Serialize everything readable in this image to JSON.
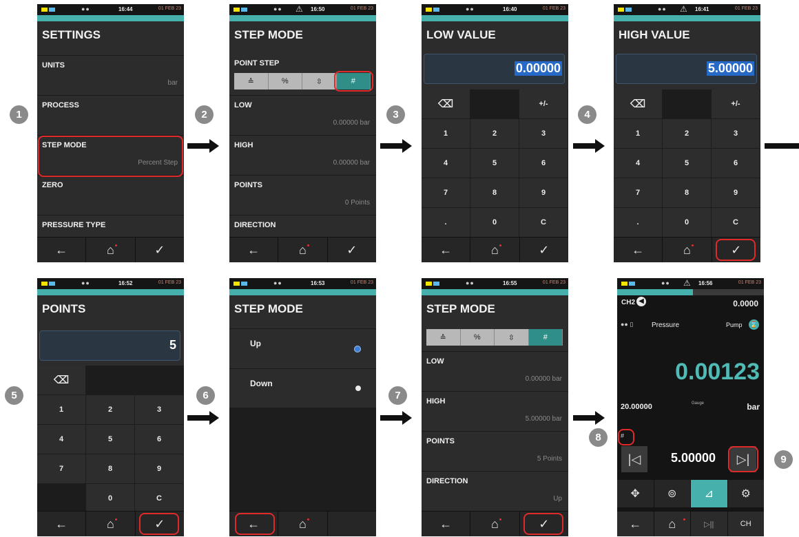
{
  "status": {
    "dots": "●●",
    "times": [
      "16:44",
      "16:50",
      "16:40",
      "16:41",
      "16:52",
      "16:53",
      "16:55",
      "16:56"
    ],
    "date": "01 FEB 23"
  },
  "screen1": {
    "title": "SETTINGS",
    "items": [
      {
        "label": "UNITS",
        "value": "bar"
      },
      {
        "label": "PROCESS",
        "value": ""
      },
      {
        "label": "STEP MODE",
        "value": "Percent Step"
      },
      {
        "label": "ZERO",
        "value": ""
      },
      {
        "label": "PRESSURE TYPE",
        "value": ""
      }
    ]
  },
  "screen2": {
    "title": "STEP MODE",
    "point_step_label": "POINT STEP",
    "items": [
      {
        "label": "LOW",
        "value": "0.00000 bar"
      },
      {
        "label": "HIGH",
        "value": "0.00000 bar"
      },
      {
        "label": "POINTS",
        "value": "0 Points"
      },
      {
        "label": "DIRECTION",
        "value": ""
      }
    ]
  },
  "screen3": {
    "title": "LOW VALUE",
    "value": "0.00000"
  },
  "screen4": {
    "title": "HIGH VALUE",
    "value": "5.00000"
  },
  "screen5": {
    "title": "POINTS",
    "value": "5"
  },
  "screen6": {
    "title": "STEP MODE",
    "options": [
      "Up",
      "Down"
    ]
  },
  "screen7": {
    "title": "STEP MODE",
    "items": [
      {
        "label": "LOW",
        "value": "0.00000 bar"
      },
      {
        "label": "HIGH",
        "value": "5.00000 bar"
      },
      {
        "label": "POINTS",
        "value": "5 Points"
      },
      {
        "label": "DIRECTION",
        "value": "Up"
      }
    ]
  },
  "screen8": {
    "channel": "CH2",
    "channel_value": "0.0000",
    "sensor_label": "Pressure",
    "pump_label": "Pump",
    "reading": "0.00123",
    "range": "20.00000",
    "pressure_type": "Gauge",
    "unit": "bar",
    "step_value": "5.00000"
  },
  "keypad": {
    "backspace": "⌫",
    "plusminus": "+/-",
    "keys": [
      "1",
      "2",
      "3",
      "4",
      "5",
      "6",
      "7",
      "8",
      "9",
      ".",
      "0",
      "C"
    ]
  },
  "nav": {
    "back": "←",
    "home": "⌂",
    "ok": "✓",
    "playpause": "▷||",
    "channel": "CH"
  },
  "step_icons": [
    "≙",
    "%",
    "⇳",
    "#"
  ],
  "badges": [
    "1",
    "2",
    "3",
    "4",
    "5",
    "6",
    "7",
    "8",
    "9"
  ],
  "colors": {
    "accent": "#46b0ad",
    "highlight": "#e02a2a",
    "screen_bg": "#2c2c2c",
    "selection": "#2769c6"
  }
}
